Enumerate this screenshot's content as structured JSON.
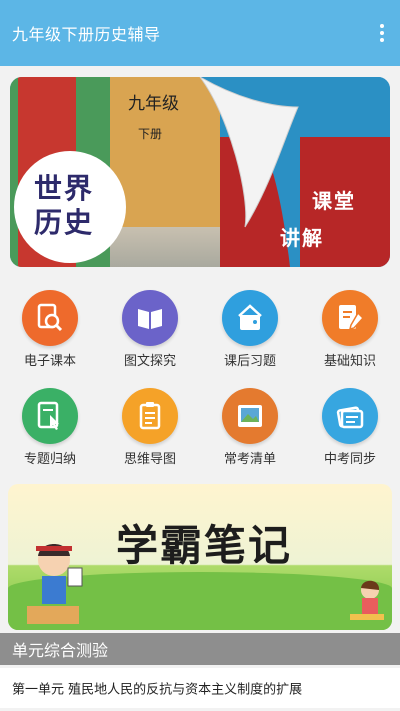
{
  "app_bar": {
    "title": "九年级下册历史辅导",
    "menu_icon": "more-vert-icon"
  },
  "banner": {
    "grade": "九年级",
    "volume": "下册",
    "book_title_line1": "世界",
    "book_title_line2": "历史",
    "lesson_line1": "课堂",
    "lesson_line2": "讲解"
  },
  "menu": [
    {
      "label": "电子课本",
      "icon": "magnify-document-icon",
      "color": "#ee6a2c"
    },
    {
      "label": "图文探究",
      "icon": "open-book-icon",
      "color": "#6b63c9"
    },
    {
      "label": "课后习题",
      "icon": "home-task-icon",
      "color": "#2f9fde"
    },
    {
      "label": "基础知识",
      "icon": "edit-document-icon",
      "color": "#f07c29"
    },
    {
      "label": "专题归纳",
      "icon": "pointer-document-icon",
      "color": "#3ab066"
    },
    {
      "label": "思维导图",
      "icon": "clipboard-icon",
      "color": "#f5a228"
    },
    {
      "label": "常考清单",
      "icon": "picture-icon",
      "color": "#e47a2f"
    },
    {
      "label": "中考同步",
      "icon": "cards-icon",
      "color": "#37a6e0"
    }
  ],
  "notes_banner": {
    "title": "学霸笔记"
  },
  "section": {
    "title": "单元综合测验"
  },
  "units": [
    {
      "label": "第一单元  殖民地人民的反抗与资本主义制度的扩展"
    }
  ]
}
